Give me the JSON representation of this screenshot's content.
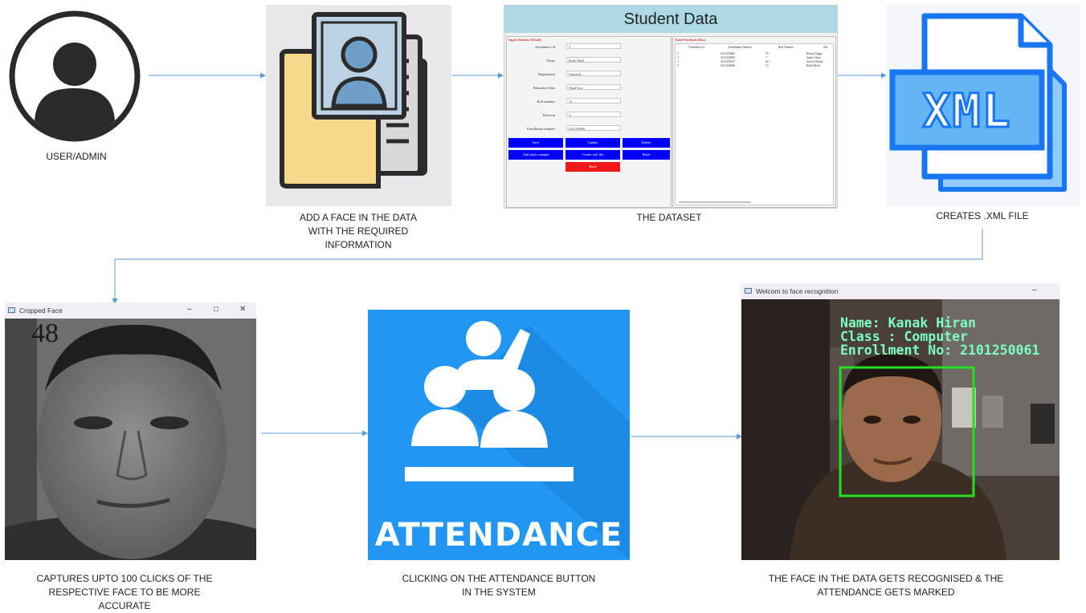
{
  "captions": {
    "user": "USER/ADMIN",
    "add_face": [
      "ADD A FACE IN THE DATA",
      "WITH THE REQUIRED",
      "INFORMATION"
    ],
    "dataset": "THE DATASET",
    "xml": "CREATES .XML FILE",
    "captures": [
      "CAPTURES UPTO 100 CLICKS OF THE",
      "RESPECTIVE FACE TO BE MORE",
      "ACCURATE"
    ],
    "attendance": [
      "CLICKING ON THE ATTENDANCE BUTTON",
      "IN THE SYSTEM"
    ],
    "recognised": [
      "THE FACE IN THE DATA GETS RECOGNISED & THE",
      "ATTENDANCE GETS MARKED"
    ]
  },
  "student_data": {
    "title": "Student  Data",
    "input_panel_title": "Input Student Details",
    "table_panel_title": "Total Students Data",
    "fields": [
      {
        "label": "Attendance id",
        "value": "5"
      },
      {
        "label": "Name",
        "value": "Boshi Modi"
      },
      {
        "label": "Department",
        "value": "Chemical"
      },
      {
        "label": "Education Year",
        "value": "Third Year"
      },
      {
        "label": "Roll number",
        "value": "13"
      },
      {
        "label": "Division",
        "value": "A"
      },
      {
        "label": "Enrollment number",
        "value": "2101250068"
      }
    ],
    "buttons": [
      "Save",
      "Update",
      "Delete",
      "Add photo sample",
      "Create xml file",
      "Reset"
    ],
    "back_button": "Back",
    "table_headers": [
      "Attendance id",
      "Enrollment Number",
      "Roll Number",
      "Nar"
    ],
    "rows": [
      [
        "1",
        "2101250060",
        "15",
        "Rohan Nagpe"
      ],
      [
        "2",
        "2101250065",
        "7",
        "Sanket Nam"
      ],
      [
        "3",
        "2101250017",
        "40",
        "Jayesh Shukle"
      ],
      [
        "4",
        "2101250068",
        "13",
        "Riddi Modi"
      ]
    ]
  },
  "xml_icon_label": "XML",
  "cropped_face": {
    "title": "Cropped Face",
    "count": "48"
  },
  "attendance_label": "ATTENDANCE",
  "recognition": {
    "title": "Welcom to face recognition",
    "overlay": [
      "Name: Kanak Hiran",
      "Class : Computer",
      "Enrollment No: 2101250061"
    ]
  },
  "colors": {
    "arrow": "#5b9bd5",
    "attendance_bg": "#2196f3",
    "xml_blue": "#1976f2",
    "sd_header": "#add8e6",
    "detect_box": "#22e022"
  }
}
